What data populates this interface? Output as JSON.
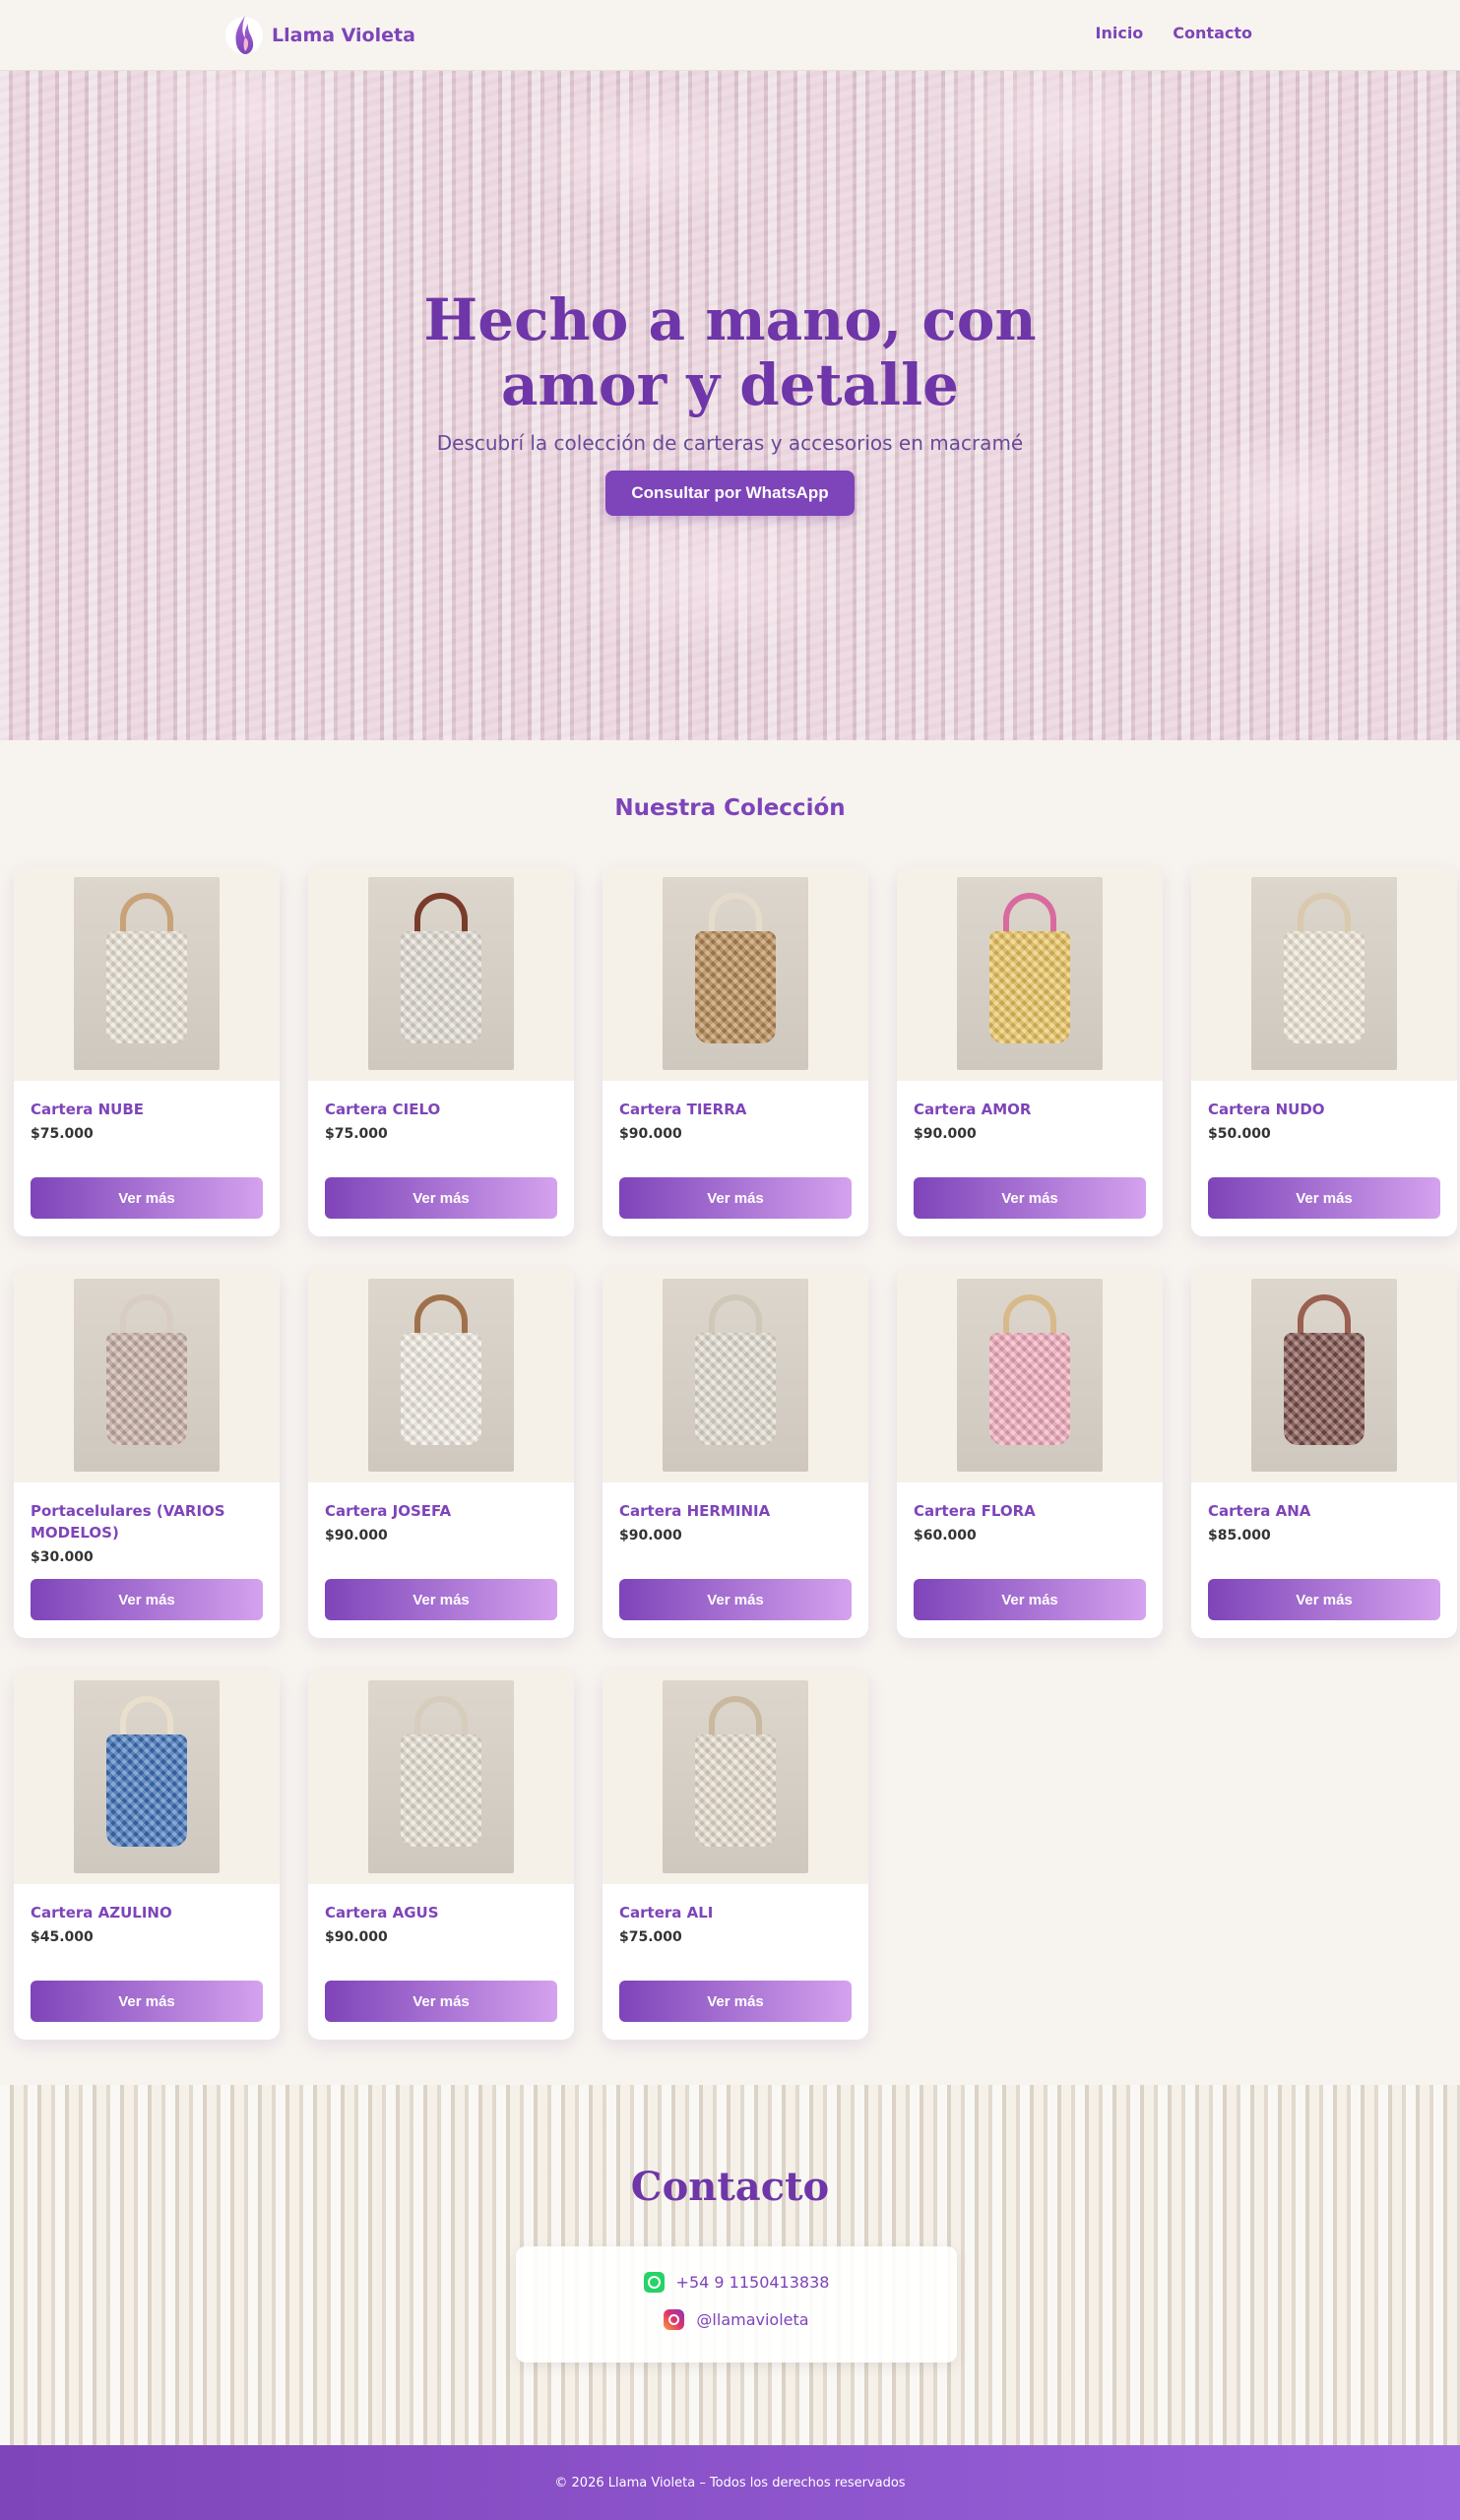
{
  "brand": {
    "name": "Llama Violeta"
  },
  "nav": {
    "links": [
      "Inicio",
      "Contacto"
    ]
  },
  "hero": {
    "title": "Hecho a mano, con amor y detalle",
    "subtitle": "Descubrí la colección de carteras y accesorios en macramé",
    "cta": "Consultar por WhatsApp"
  },
  "collection": {
    "title": "Nuestra Colección",
    "button_label": "Ver más",
    "products": [
      {
        "name": "Cartera NUBE",
        "price": "$75.000",
        "color": "#e9e2d4",
        "handle": "#c9a27a"
      },
      {
        "name": "Cartera CIELO",
        "price": "$75.000",
        "color": "#e2ddd3",
        "handle": "#7a3b2b"
      },
      {
        "name": "Cartera TIERRA",
        "price": "$90.000",
        "color": "#b5864f",
        "handle": "#e6dccb"
      },
      {
        "name": "Cartera AMOR",
        "price": "$90.000",
        "color": "#e9c25a",
        "handle": "#d96aa0"
      },
      {
        "name": "Cartera NUDO",
        "price": "$50.000",
        "color": "#efe6d6",
        "handle": "#d9c9ae"
      },
      {
        "name": "Portacelulares (VARIOS MODELOS)",
        "price": "$30.000",
        "color": "#c6aea3",
        "handle": "#d8ccc3"
      },
      {
        "name": "Cartera JOSEFA",
        "price": "$90.000",
        "color": "#f0ebe1",
        "handle": "#a0704a"
      },
      {
        "name": "Cartera HERMINIA",
        "price": "$90.000",
        "color": "#e1dbcf",
        "handle": "#cfc7b7"
      },
      {
        "name": "Cartera FLORA",
        "price": "$60.000",
        "color": "#f0a9bb",
        "handle": "#d8b98a"
      },
      {
        "name": "Cartera ANA",
        "price": "$85.000",
        "color": "#7a4a45",
        "handle": "#9a6050"
      },
      {
        "name": "Cartera AZULINO",
        "price": "$45.000",
        "color": "#3b6fb8",
        "handle": "#e9dfcc"
      },
      {
        "name": "Cartera AGUS",
        "price": "$90.000",
        "color": "#e7e0d2",
        "handle": "#d6cdbd"
      },
      {
        "name": "Cartera ALI",
        "price": "$75.000",
        "color": "#e6dccd",
        "handle": "#c9b99e"
      }
    ]
  },
  "contact": {
    "title": "Contacto",
    "whatsapp": "+54 9 1150413838",
    "instagram": "@llamavioleta"
  },
  "footer": {
    "text": "© 2026 Llama Violeta – Todos los derechos reservados"
  }
}
